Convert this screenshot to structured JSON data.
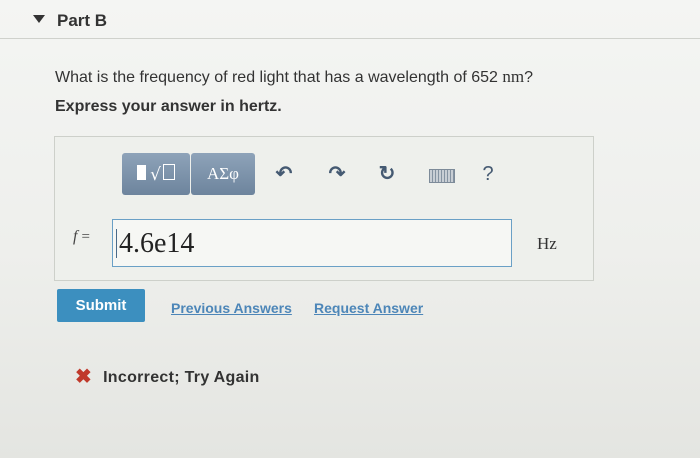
{
  "part": {
    "title": "Part B"
  },
  "question": {
    "text_before": "What is the frequency of red light that has a wavelength of 652 ",
    "unit": "nm",
    "text_after": "?",
    "instruction": "Express your answer in hertz."
  },
  "toolbar": {
    "greek_label": "ΑΣφ",
    "help_label": "?",
    "icons": [
      "templates-icon",
      "undo-icon",
      "redo-icon",
      "reset-icon",
      "keyboard-icon",
      "help-icon"
    ]
  },
  "answer": {
    "variable": "f",
    "equals": "=",
    "value": "4.6e14",
    "unit": "Hz"
  },
  "actions": {
    "submit_label": "Submit",
    "previous_answers_label": "Previous Answers",
    "request_answer_label": "Request Answer"
  },
  "feedback": {
    "text": "Incorrect; Try Again",
    "status_color": "#c0392b"
  },
  "colors": {
    "accent": "#3c8fbf",
    "toolbar_button": "#7b90a7",
    "link": "#4d86b8"
  }
}
